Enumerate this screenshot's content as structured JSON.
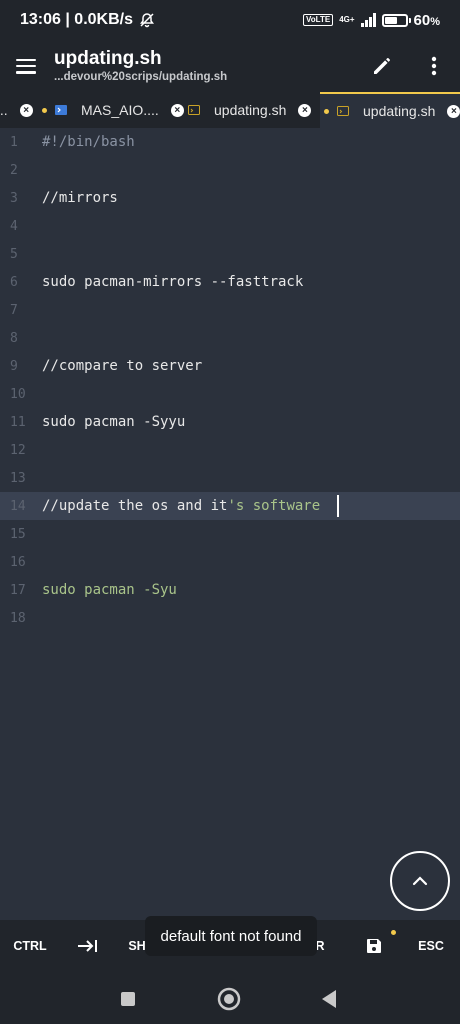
{
  "status_bar": {
    "time_speed": "13:06 | 0.0KB/s",
    "volte": "VoLTE",
    "network": "4G+",
    "battery_percent": "60",
    "battery_suffix": "%",
    "battery_level": 0.6
  },
  "app_bar": {
    "title": "updating.sh",
    "subtitle": "...devour%20scrips/updating.sh"
  },
  "tabs": [
    {
      "label": "...",
      "modified": false,
      "active": false
    },
    {
      "label": "MAS_AIO....",
      "modified": true,
      "active": false
    },
    {
      "label": "updating.sh",
      "modified": false,
      "active": false
    },
    {
      "label": "updating.sh",
      "modified": true,
      "active": true
    }
  ],
  "editor": {
    "current_line": 14,
    "lines": [
      {
        "num": "1",
        "segments": [
          {
            "text": "#!/bin/bash",
            "style": "comment"
          }
        ]
      },
      {
        "num": "2",
        "segments": []
      },
      {
        "num": "3",
        "segments": [
          {
            "text": "//mirrors",
            "style": "plain"
          }
        ]
      },
      {
        "num": "4",
        "segments": []
      },
      {
        "num": "5",
        "segments": []
      },
      {
        "num": "6",
        "segments": [
          {
            "text": "sudo pacman-mirrors --fasttrack",
            "style": "plain"
          }
        ]
      },
      {
        "num": "7",
        "segments": []
      },
      {
        "num": "8",
        "segments": []
      },
      {
        "num": "9",
        "segments": [
          {
            "text": "//compare to server",
            "style": "plain"
          }
        ]
      },
      {
        "num": "10",
        "segments": []
      },
      {
        "num": "11",
        "segments": [
          {
            "text": "sudo pacman -Syyu",
            "style": "plain"
          }
        ]
      },
      {
        "num": "12",
        "segments": []
      },
      {
        "num": "13",
        "segments": []
      },
      {
        "num": "14",
        "segments": [
          {
            "text": "//update the os and it",
            "style": "plain"
          },
          {
            "text": "'s software ",
            "style": "green"
          }
        ]
      },
      {
        "num": "15",
        "segments": []
      },
      {
        "num": "16",
        "segments": []
      },
      {
        "num": "17",
        "segments": [
          {
            "text": "sudo pacman -Syu",
            "style": "green"
          }
        ]
      },
      {
        "num": "18",
        "segments": []
      }
    ]
  },
  "keys": {
    "ctrl": "CTRL",
    "tab_icon": "tab-arrow-icon",
    "shift": "SH",
    "search_fragment": "R",
    "save_icon": "save-icon",
    "esc": "ESC"
  },
  "toast": "default font not found",
  "colors": {
    "background": "#2b313c",
    "bars": "#21252b",
    "accent": "#f2c94c",
    "comment": "#8a93a3",
    "string": "#a9c48a"
  }
}
